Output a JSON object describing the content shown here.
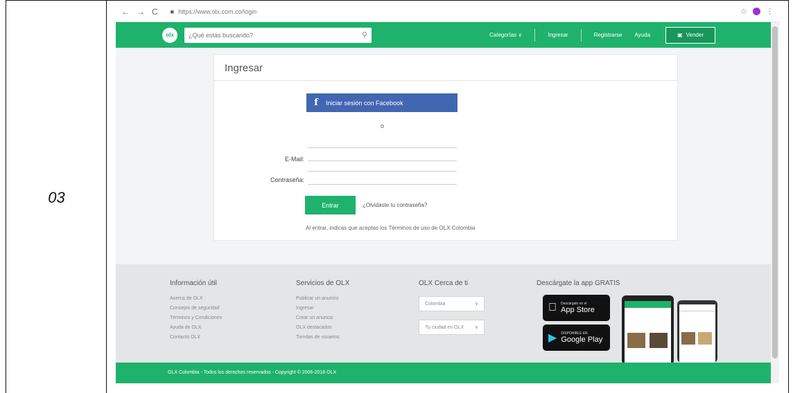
{
  "document": {
    "row_label": "03"
  },
  "browser": {
    "back": "←",
    "forward": "→",
    "reload": "C",
    "url": "https://www.olx.com.co/login",
    "star": "☆",
    "menu": "⋮"
  },
  "header": {
    "logo": "olx",
    "search_placeholder": "¿Qué estás buscando?",
    "nav": [
      "Categorías ∨",
      "Ingresar",
      "Registrarse",
      "Ayuda"
    ],
    "sell_label": "Vender"
  },
  "login": {
    "title": "Ingresar",
    "facebook_label": "Iniciar sesión con Facebook",
    "or": "o",
    "email_label": "E-Mail:",
    "password_label": "Contraseña:",
    "submit_label": "Entrar",
    "forgot": "¿Olvidaste tu contraseña?",
    "terms": "Al entrar, indicas que aceptas los Términos de uso de OLX Colombia"
  },
  "footer": {
    "col1": {
      "heading": "Información útil",
      "links": [
        "Acerca de OLX",
        "Consejos de seguridad",
        "Términos y Condiciones",
        "Ayuda de OLX",
        "Contacto OLX"
      ]
    },
    "col2": {
      "heading": "Servicios de OLX",
      "links": [
        "Publicar un anuncio",
        "Ingresar",
        "Crear un anuncio",
        "OLX destacados",
        "Tiendas de usuarios"
      ]
    },
    "col3": {
      "heading": "OLX Cerca de ti",
      "selects": [
        "Colombia",
        "Tu ciudad en OLX"
      ]
    },
    "col4": {
      "heading": "Descárgate la app GRATIS"
    },
    "appstore": {
      "small": "Descárgalo en el",
      "big": "App Store"
    },
    "googleplay": {
      "small": "DISPONIBLE EN",
      "big": "Google Play"
    },
    "copyright": "OLX Colombia - Todos los derechos reservados - Copyright © 2006-2018 OLX"
  },
  "colors": {
    "brand_green": "#1fb26c",
    "facebook_blue": "#4267b2"
  }
}
